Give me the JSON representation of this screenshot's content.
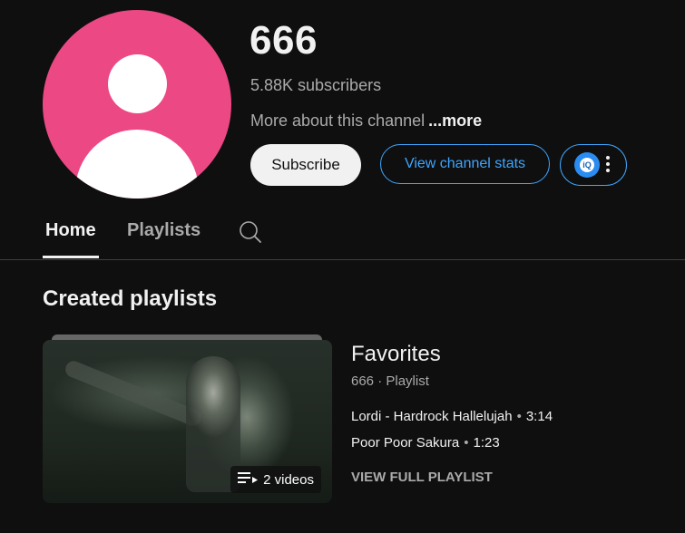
{
  "channel": {
    "name": "666",
    "subscribers": "5.88K subscribers",
    "about_text": "More about this channel",
    "about_more": "...more",
    "avatar_color": "#ec4884"
  },
  "actions": {
    "subscribe_label": "Subscribe",
    "stats_label": "View channel stats",
    "extension_icon": "iq-icon",
    "extension_label": "iQ"
  },
  "tabs": [
    {
      "label": "Home",
      "active": true
    },
    {
      "label": "Playlists",
      "active": false
    }
  ],
  "section": {
    "title": "Created playlists"
  },
  "playlist": {
    "title": "Favorites",
    "meta": "666 · Playlist",
    "video_count": "2 videos",
    "videos": [
      {
        "title": "Lordi - Hardrock Hallelujah",
        "duration": "3:14"
      },
      {
        "title": "Poor Poor Sakura",
        "duration": "1:23"
      }
    ],
    "view_full": "VIEW FULL PLAYLIST"
  },
  "colors": {
    "accent": "#3ea6ff",
    "background": "#0f0f0f"
  }
}
